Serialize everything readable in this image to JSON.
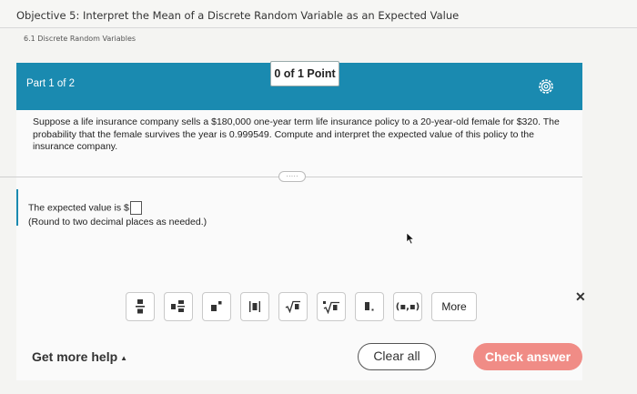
{
  "header": {
    "objective_title": "Objective 5: Interpret the Mean of a Discrete Random Variable as an Expected Value",
    "section_label": "6.1 Discrete Random Variables"
  },
  "part_bar": {
    "part_label": "Part 1 of 2",
    "points": "0 of 1 Point",
    "gear_icon": "gear-icon",
    "color": "#1a8ab0"
  },
  "question": {
    "text": "Suppose a life insurance company sells a $180,000 one-year term life insurance policy to a 20-year-old female for $320. The probability that the female survives the year is 0.999549. Compute and interpret the expected value of this policy to the insurance company.",
    "expand_label": "·····"
  },
  "answer": {
    "prompt": "The expected value is $",
    "value": "",
    "round_note": "(Round to two decimal places as needed.)"
  },
  "toolbar": {
    "tools": [
      {
        "icon": "fraction-icon"
      },
      {
        "icon": "mixed-number-icon"
      },
      {
        "icon": "exponent-icon"
      },
      {
        "icon": "absolute-value-icon"
      },
      {
        "icon": "square-root-icon"
      },
      {
        "icon": "nth-root-icon"
      },
      {
        "icon": "decimal-icon"
      },
      {
        "icon": "ordered-pair-icon",
        "label": "(▪,▪)"
      }
    ],
    "more_label": "More",
    "close_icon": "close-icon"
  },
  "footer": {
    "help_label": "Get more help",
    "help_caret": "▲",
    "clear_label": "Clear all",
    "check_label": "Check answer",
    "check_color": "#f08c86"
  }
}
